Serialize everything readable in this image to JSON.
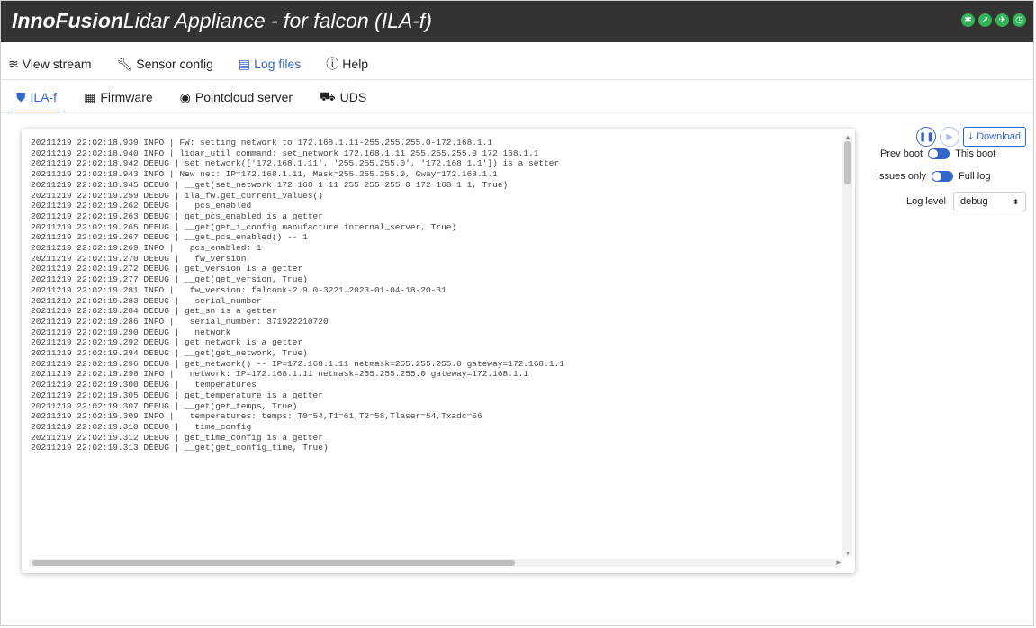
{
  "app": {
    "brand": "InnoFusion",
    "title_rest": "Lidar Appliance - for falcon (ILA-f)",
    "status_icons": [
      "bug-icon",
      "running-icon",
      "plane-icon",
      "clock-icon"
    ],
    "accent_color": "#3366cc",
    "status_color": "#2fb457"
  },
  "main_nav": [
    {
      "label": "View stream",
      "icon": "stream-icon",
      "active": false
    },
    {
      "label": "Sensor config",
      "icon": "wrench-icon",
      "active": false
    },
    {
      "label": "Log files",
      "icon": "file-icon",
      "active": true
    },
    {
      "label": "Help",
      "icon": "info-icon",
      "active": false
    }
  ],
  "sub_tabs": [
    {
      "label": "ILA-f",
      "icon": "html5-icon",
      "active": true
    },
    {
      "label": "Firmware",
      "icon": "chip-icon",
      "active": false
    },
    {
      "label": "Pointcloud server",
      "icon": "disc-icon",
      "active": false
    },
    {
      "label": "UDS",
      "icon": "car-icon",
      "active": false
    }
  ],
  "controls": {
    "download_label": "Download",
    "prev_boot_label": "Prev boot",
    "this_boot_label": "This boot",
    "issues_only_label": "Issues only",
    "full_log_label": "Full log",
    "log_level_label": "Log level",
    "log_level_value": "debug"
  },
  "log_lines": [
    "20211219 22:02:18.939 INFO | FW: setting network to 172.168.1.11-255.255.255.0-172.168.1.1",
    "20211219 22:02:18.940 INFO | lidar_util command: set_network 172.168.1.11 255.255.255.0 172.168.1.1",
    "20211219 22:02:18.942 DEBUG | set_network(['172.168.1.11', '255.255.255.0', '172.168.1.1']) is a setter",
    "20211219 22:02:18.943 INFO | New net: IP=172.168.1.11, Mask=255.255.255.0, Gway=172.168.1.1",
    "20211219 22:02:18.945 DEBUG | __get(set_network 172 168 1 11 255 255 255 0 172 168 1 1, True)",
    "20211219 22:02:19.259 DEBUG | ila_fw.get_current_values()",
    "20211219 22:02:19.262 DEBUG |   pcs_enabled",
    "20211219 22:02:19.263 DEBUG | get_pcs_enabled is a getter",
    "20211219 22:02:19.265 DEBUG | __get(get_i_config manufacture internal_server, True)",
    "20211219 22:02:19.267 DEBUG | __get_pcs_enabled() -- 1",
    "20211219 22:02:19.269 INFO |   pcs_enabled: 1",
    "20211219 22:02:19.270 DEBUG |   fw_version",
    "20211219 22:02:19.272 DEBUG | get_version is a getter",
    "20211219 22:02:19.277 DEBUG | __get(get_version, True)",
    "20211219 22:02:19.281 INFO |   fw_version: falconk-2.9.0-3221.2023-01-04-18-20-31",
    "20211219 22:02:19.283 DEBUG |   serial_number",
    "20211219 22:02:19.284 DEBUG | get_sn is a getter",
    "20211219 22:02:19.286 INFO |   serial_number: 371922210720",
    "20211219 22:02:19.290 DEBUG |   network",
    "20211219 22:02:19.292 DEBUG | get_network is a getter",
    "20211219 22:02:19.294 DEBUG | __get(get_network, True)",
    "20211219 22:02:19.296 DEBUG | get_network() -- IP=172.168.1.11 netmask=255.255.255.0 gateway=172.168.1.1",
    "20211219 22:02:19.298 INFO |   network: IP=172.168.1.11 netmask=255.255.255.0 gateway=172.168.1.1",
    "20211219 22:02:19.300 DEBUG |   temperatures",
    "20211219 22:02:19.305 DEBUG | get_temperature is a getter",
    "20211219 22:02:19.307 DEBUG | __get(get_temps, True)",
    "20211219 22:02:19.309 INFO |   temperatures: temps: T0=54,T1=61,T2=58,Tlaser=54,Txadc=56",
    "20211219 22:02:19.310 DEBUG |   time_config",
    "20211219 22:02:19.312 DEBUG | get_time_config is a getter",
    "20211219 22:02:19.313 DEBUG | __get(get_config_time, True)"
  ]
}
